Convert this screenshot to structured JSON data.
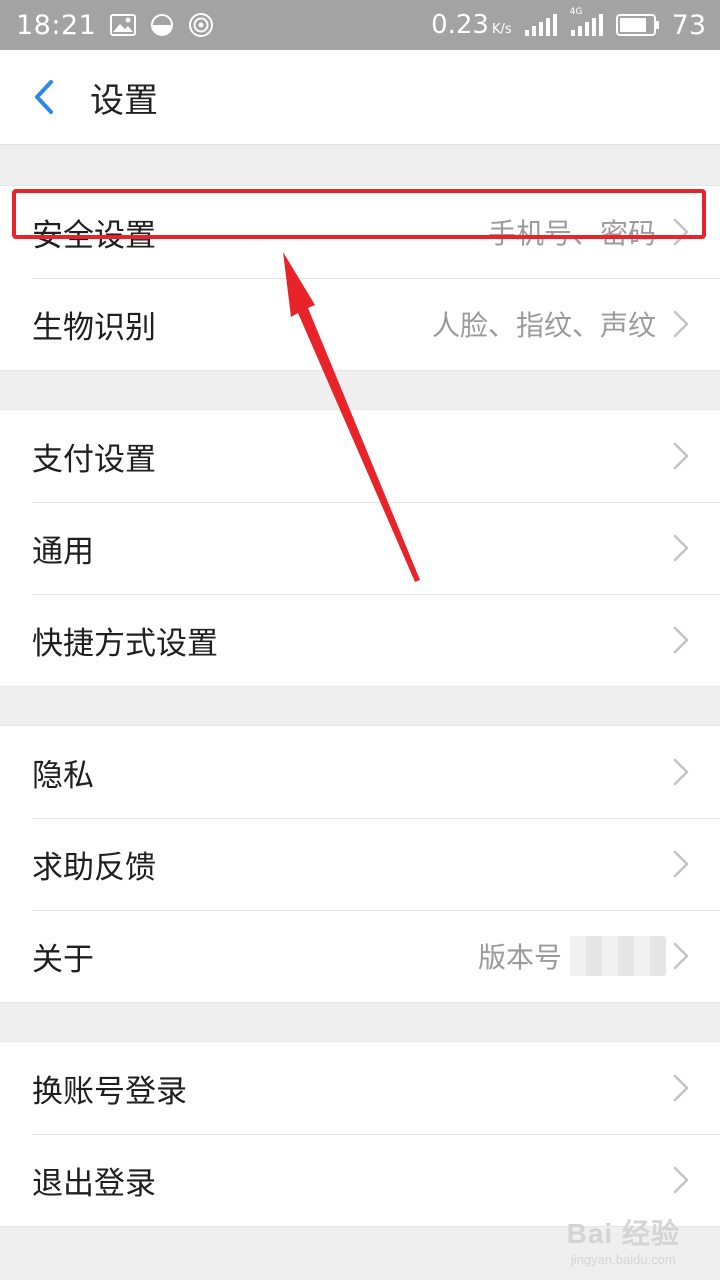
{
  "status_bar": {
    "time": "18:21",
    "speed": "0.23",
    "speed_unit": "K/s",
    "network": "4G",
    "battery": "73"
  },
  "header": {
    "title": "设置"
  },
  "groups": [
    [
      {
        "label": "安全设置",
        "value": "手机号、密码"
      },
      {
        "label": "生物识别",
        "value": "人脸、指纹、声纹"
      }
    ],
    [
      {
        "label": "支付设置"
      },
      {
        "label": "通用"
      },
      {
        "label": "快捷方式设置"
      }
    ],
    [
      {
        "label": "隐私"
      },
      {
        "label": "求助反馈"
      },
      {
        "label": "关于",
        "value": "版本号"
      }
    ],
    [
      {
        "label": "换账号登录"
      },
      {
        "label": "退出登录"
      }
    ]
  ],
  "watermark": {
    "main": "Bai 经验",
    "sub": "jingyan.baidu.com"
  },
  "colors": {
    "status_bar": "#a3a3a3",
    "accent_blue": "#2a8ae6",
    "annotation_red": "#e8242a"
  }
}
